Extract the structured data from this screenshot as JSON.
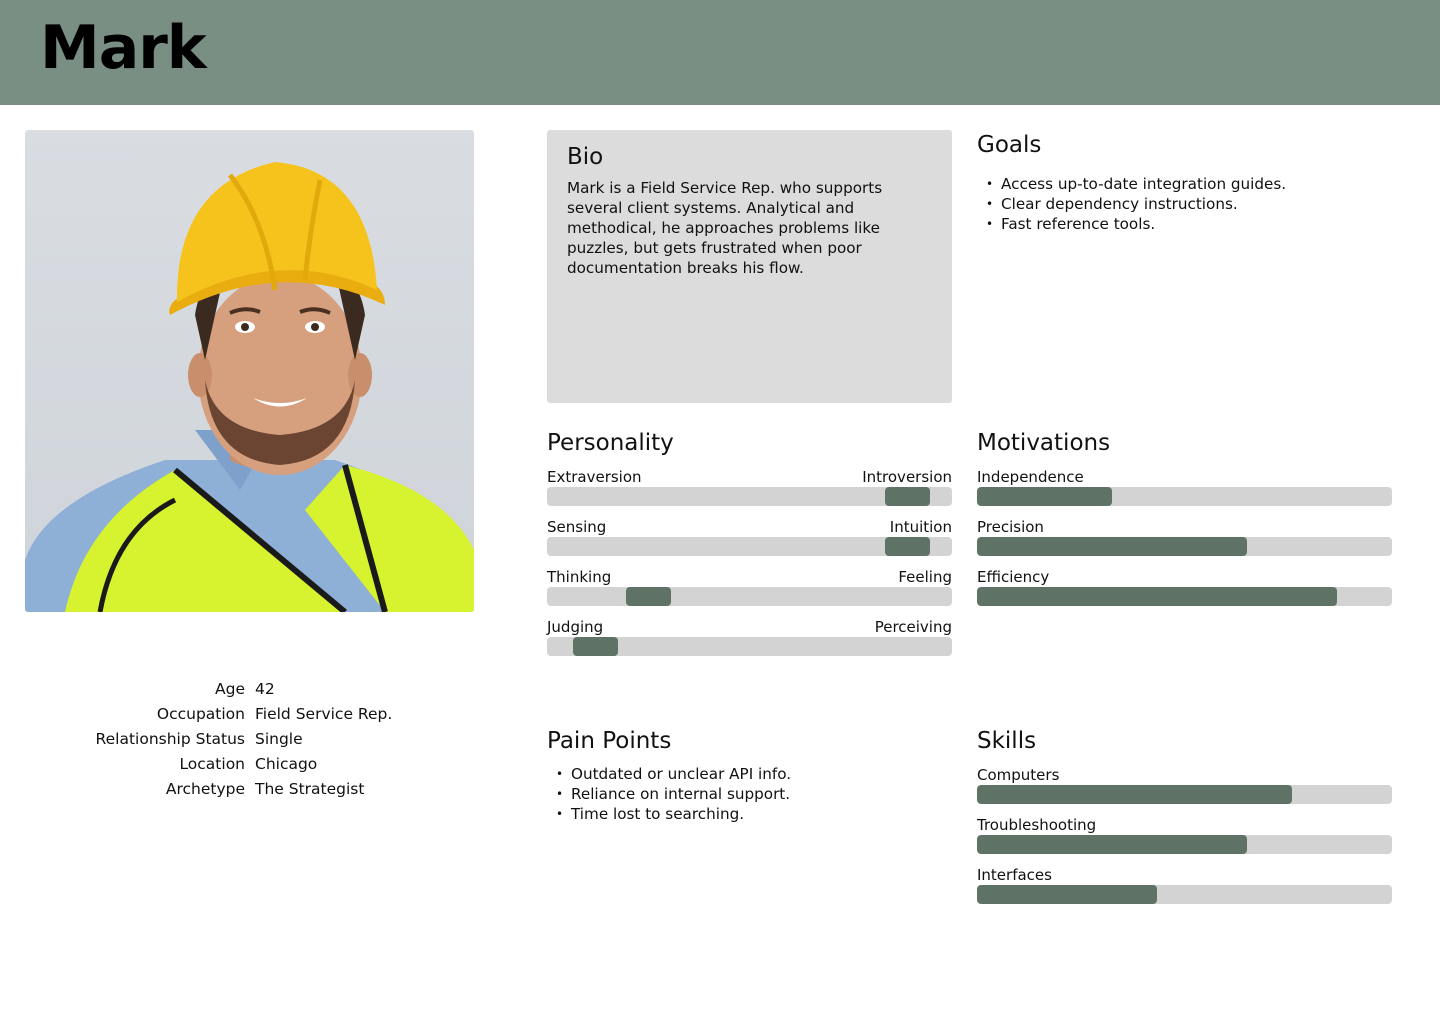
{
  "header": {
    "name": "Mark"
  },
  "photo": {
    "icon": "persona-photo"
  },
  "info": [
    {
      "key": "Age",
      "value": "42"
    },
    {
      "key": "Occupation",
      "value": "Field Service Rep."
    },
    {
      "key": "Relationship Status",
      "value": "Single"
    },
    {
      "key": "Location",
      "value": "Chicago"
    },
    {
      "key": "Archetype",
      "value": "The Strategist"
    }
  ],
  "bio": {
    "title": "Bio",
    "text": "Mark is a Field Service Rep. who supports several client systems. Analytical and methodical, he approaches problems like puzzles, but gets frustrated when poor documentation breaks his flow."
  },
  "goals": {
    "title": "Goals",
    "items": [
      "Access up-to-date integration guides.",
      "Clear dependency instructions.",
      "Fast reference tools."
    ]
  },
  "personality": {
    "title": "Personality",
    "traits": [
      {
        "left": "Extraversion",
        "right": "Introversion",
        "value": 0.89
      },
      {
        "left": "Sensing",
        "right": "Intuition",
        "value": 0.89
      },
      {
        "left": "Thinking",
        "right": "Feeling",
        "value": 0.25
      },
      {
        "left": "Judging",
        "right": "Perceiving",
        "value": 0.12
      }
    ]
  },
  "motivations": {
    "title": "Motivations",
    "items": [
      {
        "label": "Independence",
        "value": 0.325
      },
      {
        "label": "Precision",
        "value": 0.65
      },
      {
        "label": "Efficiency",
        "value": 0.867
      }
    ]
  },
  "pain_points": {
    "title": "Pain Points",
    "items": [
      "Outdated or unclear API info.",
      "Reliance on internal support.",
      "Time lost to searching."
    ]
  },
  "skills": {
    "title": "Skills",
    "items": [
      {
        "label": "Computers",
        "value": 0.76
      },
      {
        "label": "Troubleshooting",
        "value": 0.65
      },
      {
        "label": "Interfaces",
        "value": 0.434
      }
    ]
  },
  "colors": {
    "header": "#7a8f83",
    "bar_fill": "#5f7266",
    "track": "#d3d3d3",
    "bio_bg": "#dcdcdc"
  }
}
